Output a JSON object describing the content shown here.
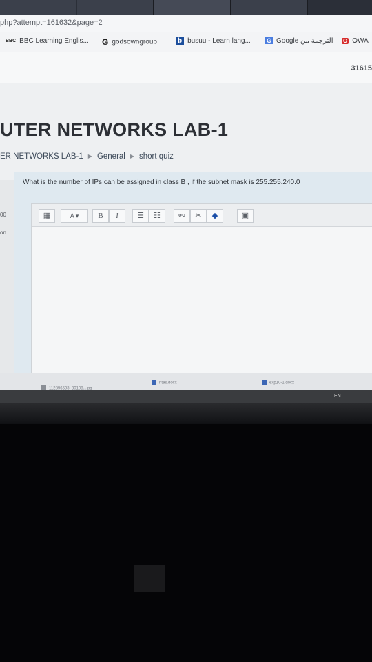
{
  "browser": {
    "url": "php?attempt=161632&page=2",
    "bookmarks": [
      {
        "icon_text": "BBC",
        "label": "BBC Learning Englis..."
      },
      {
        "icon_text": "G",
        "label": "godsowngroup"
      },
      {
        "icon_text": "b",
        "label": "busuu - Learn lang..."
      },
      {
        "icon_text": "G",
        "label": "Google الترجمة من"
      },
      {
        "icon_text": "O",
        "label": "OWA"
      }
    ]
  },
  "site": {
    "number_fragment": "31615"
  },
  "page": {
    "course_title": "UTER NETWORKS LAB-1",
    "breadcrumb": [
      "ER NETWORKS LAB-1",
      "General",
      "short quiz"
    ]
  },
  "sidebar": {
    "fragment_1": "00",
    "fragment_2": "on"
  },
  "question": {
    "text": "What is the number of IPs can be assigned  in class B , if the subnet mask is  255.255.240.0"
  },
  "editor": {
    "toolbar": {
      "font_size_label": "A",
      "bold_label": "B",
      "italic_label": "I"
    },
    "content": ""
  },
  "downloads": [
    {
      "label": "112896593_30108...jpg"
    },
    {
      "label": "ntes.docx"
    },
    {
      "label": "exp10-1.docx"
    }
  ],
  "system_tray": {
    "language": "EN"
  }
}
